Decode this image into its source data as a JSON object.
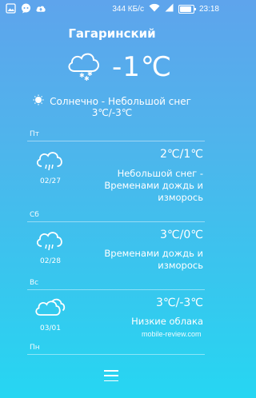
{
  "status_bar": {
    "icons": [
      "gallery-icon",
      "chat-icon",
      "cloud-upload-icon"
    ],
    "network_speed": "344 КБ/с",
    "time": "23:18",
    "battery_level": 0.85
  },
  "city": "Гагаринский",
  "current": {
    "temperature": "-1℃",
    "condition": "Солнечно - Небольшой снег",
    "range": "3℃/-3℃",
    "icon": "snow-cloud-icon"
  },
  "days": [
    {
      "day": "Пт",
      "date": "02/27",
      "temp": "2℃/1℃",
      "description": [
        "Небольшой снег -",
        "Временами дождь и",
        "изморось"
      ],
      "icon": "rain-cloud-icon"
    },
    {
      "day": "Сб",
      "date": "02/28",
      "temp": "3℃/0℃",
      "description": [
        "Временами дождь и",
        "изморось"
      ],
      "icon": "rain-cloud-icon"
    },
    {
      "day": "Вс",
      "date": "03/01",
      "temp": "3℃/-3℃",
      "description": [
        "Низкие облака"
      ],
      "icon": "cloudy-icon"
    }
  ],
  "next_day": "Пн",
  "watermark": "mobile-review.com",
  "colors": {
    "top": "#5ea4ec",
    "bottom": "#26d6f2",
    "text": "#ffffff"
  }
}
